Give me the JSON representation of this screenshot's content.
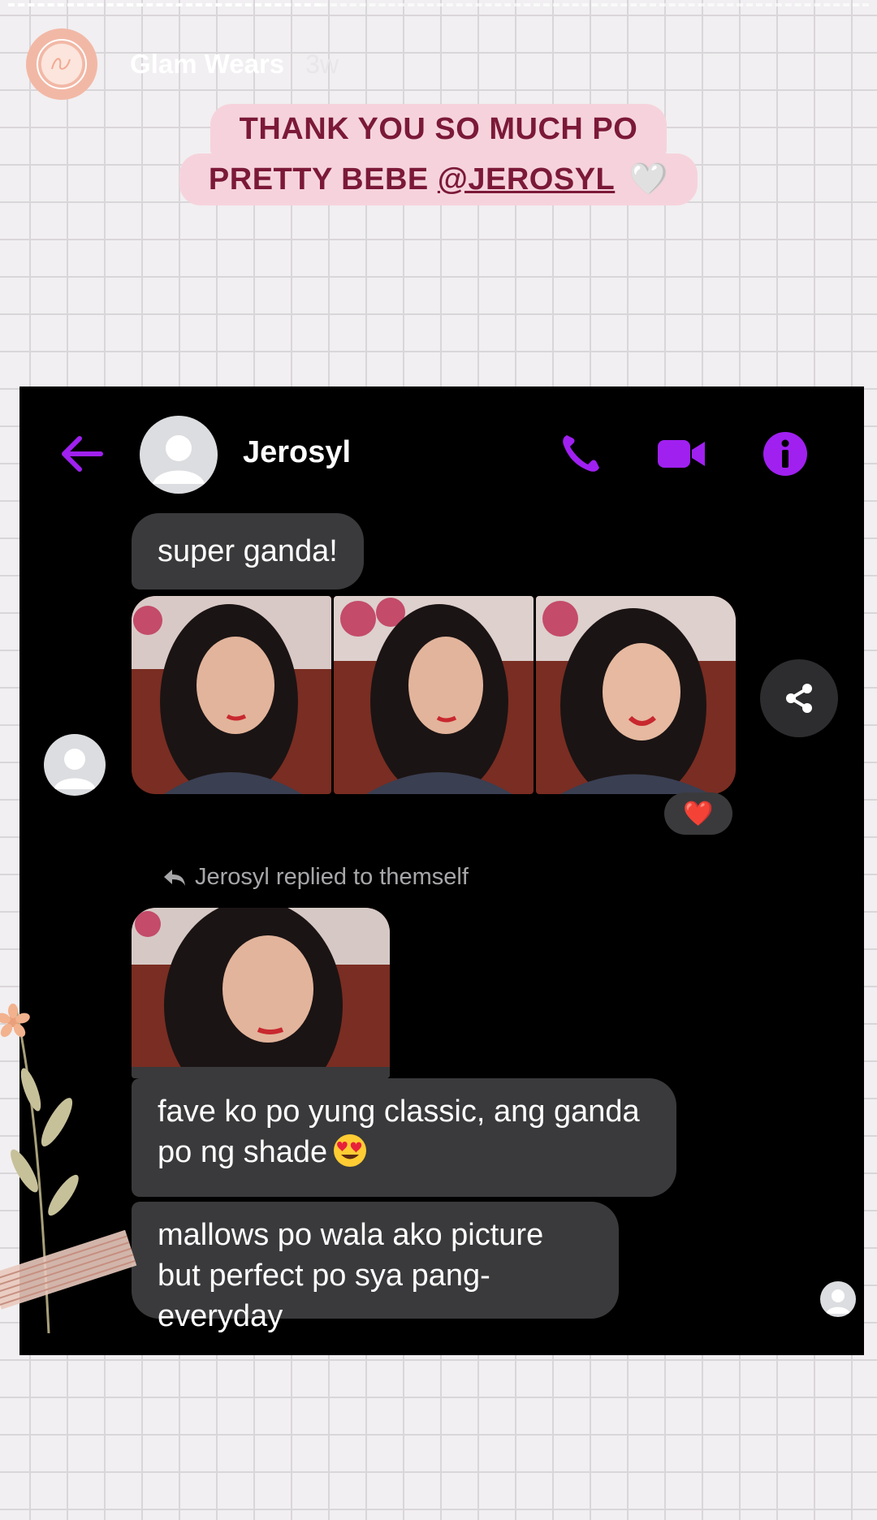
{
  "story": {
    "username": "Glam Wears",
    "posted_ago": "3w",
    "avatar_icon": "glam-wears-logo-icon"
  },
  "caption": {
    "line1": "THANK YOU SO MUCH PO",
    "line2_prefix": "PRETTY BEBE ",
    "mention": "@JEROSYL",
    "heart": "🤍"
  },
  "chat": {
    "contact_name": "Jerosyl",
    "accent_color": "#a020f0",
    "header_icons": [
      "back-arrow-icon",
      "phone-icon",
      "video-camera-icon",
      "info-icon"
    ],
    "messages": [
      {
        "text": "super ganda!"
      },
      {
        "text": "fave ko po yung classic, ang ganda po ng shade",
        "emoji": "😍"
      },
      {
        "text": "mallows po wala ako picture but perfect po sya pang-everyday"
      }
    ],
    "reply_note": "Jerosyl replied to themself",
    "reaction": "❤️"
  }
}
